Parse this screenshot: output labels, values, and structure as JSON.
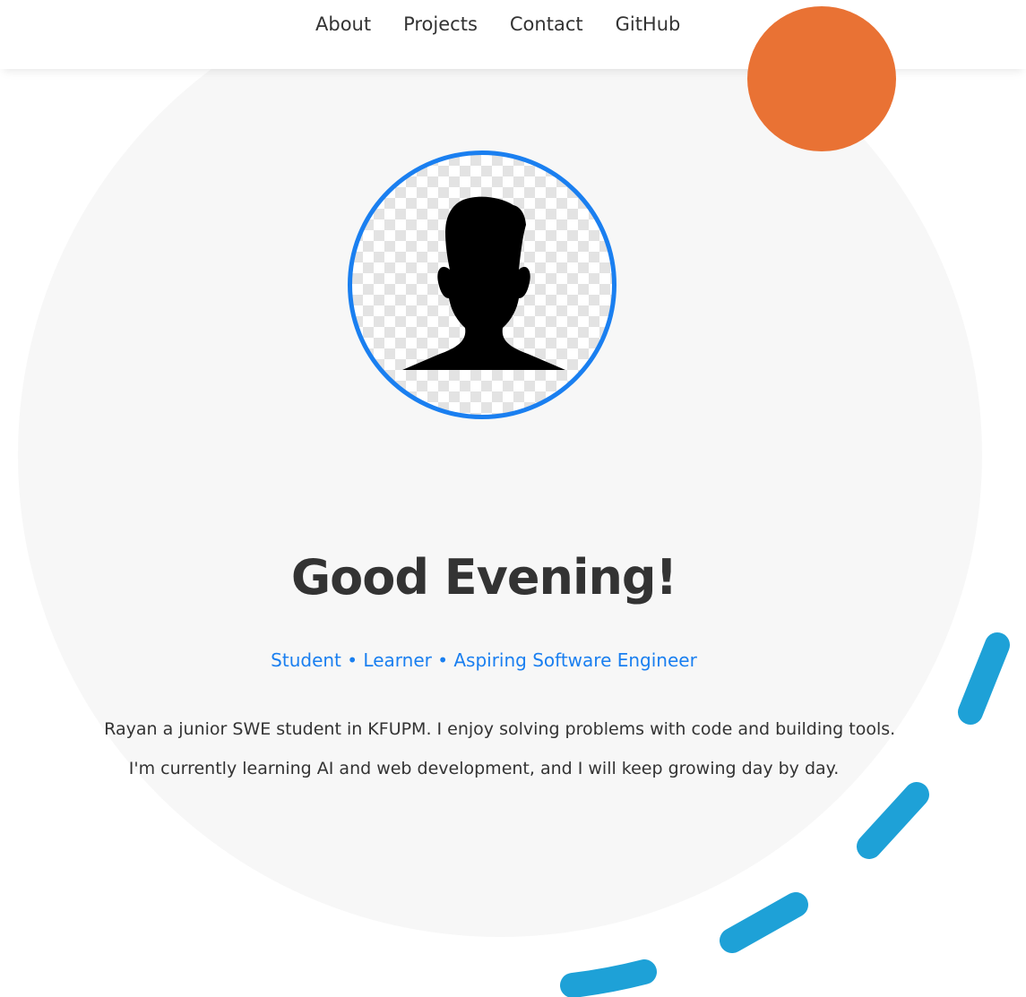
{
  "nav": {
    "links": [
      {
        "label": "About"
      },
      {
        "label": "Projects"
      },
      {
        "label": "Contact"
      },
      {
        "label": "GitHub"
      }
    ]
  },
  "hero": {
    "greeting": "Good Evening!",
    "tagline": "Student • Learner • Aspiring Software Engineer",
    "bio": "I'm Rayan a junior SWE student in KFUPM. I enjoy solving problems with code and building tools. I'm currently learning AI and web development, and I will keep growing day by day.",
    "avatar_icon": "person-silhouette-icon"
  },
  "colors": {
    "accent_blue": "#1a7ff0",
    "accent_orange": "#e97234",
    "dash_blue": "#1ea1d7",
    "background_circle": "#f7f7f7",
    "text_dark": "#333333"
  }
}
